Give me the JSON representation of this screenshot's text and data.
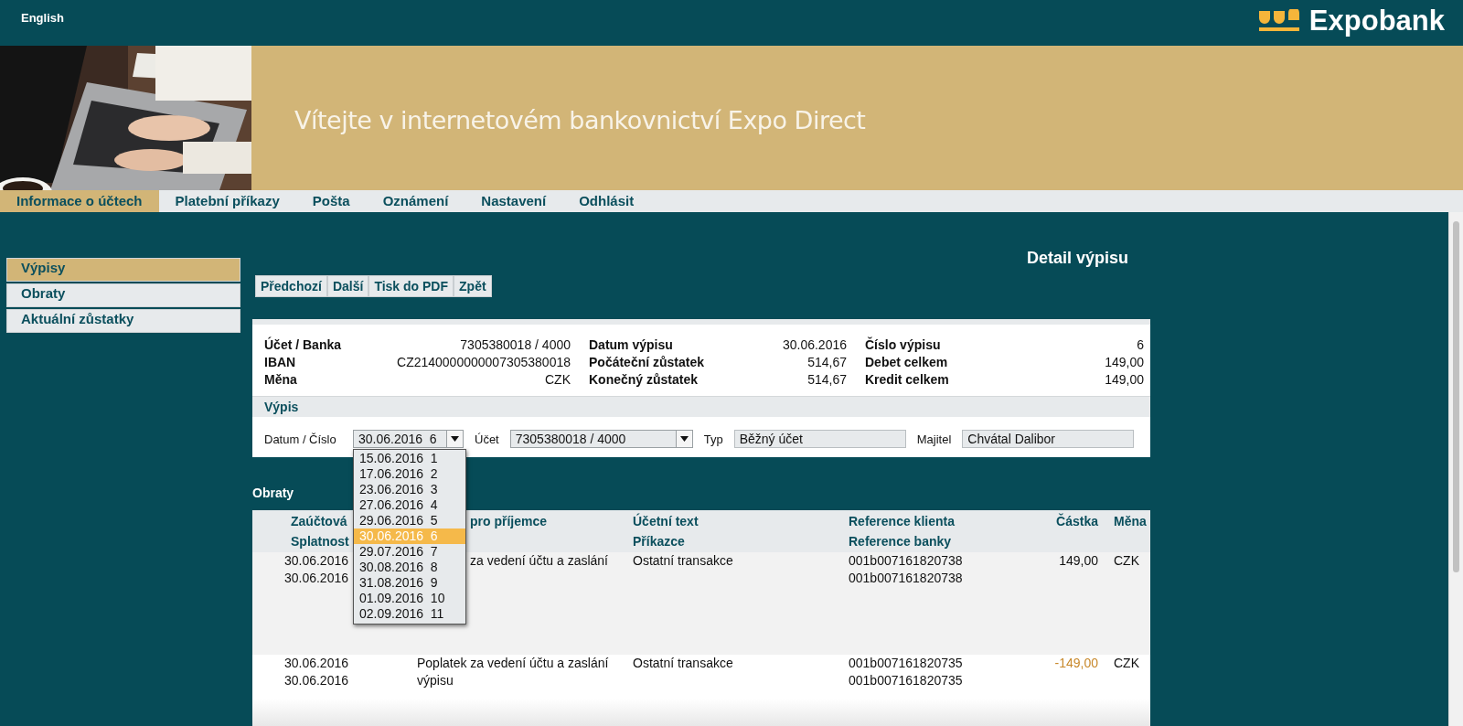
{
  "header": {
    "language_link": "English",
    "logo_text": "Expobank"
  },
  "banner": {
    "welcome": "Vítejte v internetovém bankovnictví Expo Direct"
  },
  "nav_tabs": [
    {
      "label": "Informace o účtech",
      "selected": true
    },
    {
      "label": "Platební příkazy",
      "selected": false
    },
    {
      "label": "Pošta",
      "selected": false
    },
    {
      "label": "Oznámení",
      "selected": false
    },
    {
      "label": "Nastavení",
      "selected": false
    },
    {
      "label": "Odhlásit",
      "selected": false
    }
  ],
  "sidebar": {
    "items": [
      {
        "label": "Výpisy",
        "selected": true
      },
      {
        "label": "Obraty",
        "selected": false
      },
      {
        "label": "Aktuální zůstatky",
        "selected": false
      }
    ]
  },
  "page_title": "Detail výpisu",
  "toolbar_buttons": [
    "Předchozí",
    "Další",
    "Tisk do PDF",
    "Zpět"
  ],
  "summary": {
    "fields": [
      {
        "label": "Účet  / Banka",
        "value": "7305380018 / 4000"
      },
      {
        "label": "Datum výpisu",
        "value": "30.06.2016"
      },
      {
        "label": "Číslo výpisu",
        "value": "6"
      },
      {
        "label": "IBAN",
        "value": "CZ2140000000007305380018"
      },
      {
        "label": "Počáteční zůstatek",
        "value": "514,67"
      },
      {
        "label": "Debet celkem",
        "value": "149,00"
      },
      {
        "label": "Měna",
        "value": "CZK"
      },
      {
        "label": "Konečný zůstatek",
        "value": "514,67"
      },
      {
        "label": "Kredit celkem",
        "value": "149,00"
      }
    ]
  },
  "statement": {
    "title": "Výpis",
    "controls": [
      {
        "kind": "select",
        "label": "Datum / Číslo",
        "value": "30.06.2016  6",
        "expanded": true,
        "options": [
          {
            "label": "15.06.2016  1",
            "selected": false
          },
          {
            "label": "17.06.2016  2",
            "selected": false
          },
          {
            "label": "23.06.2016  3",
            "selected": false
          },
          {
            "label": "27.06.2016  4",
            "selected": false
          },
          {
            "label": "29.06.2016  5",
            "selected": false
          },
          {
            "label": "30.06.2016  6",
            "selected": true
          },
          {
            "label": "29.07.2016  7",
            "selected": false
          },
          {
            "label": "30.08.2016  8",
            "selected": false
          },
          {
            "label": "31.08.2016  9",
            "selected": false
          },
          {
            "label": "01.09.2016  10",
            "selected": false
          },
          {
            "label": "02.09.2016  11",
            "selected": false
          }
        ]
      },
      {
        "kind": "select",
        "label": "Účet",
        "value": "7305380018 / 4000",
        "expanded": false
      },
      {
        "kind": "field",
        "label": "Typ",
        "value": "Běžný účet"
      },
      {
        "kind": "field",
        "label": "Majitel",
        "value": "Chvátal Dalibor"
      }
    ]
  },
  "turnovers": {
    "title": "Obraty",
    "columns": [
      {
        "lines": [
          "Zaúčtová",
          "Splatnost"
        ]
      },
      {
        "lines": [
          "pro příjemce"
        ],
        "partly_hidden": true
      },
      {
        "lines": [
          "Účetní text",
          "Příkazce"
        ]
      },
      {
        "lines": [
          "Reference klienta",
          "Reference banky"
        ]
      },
      {
        "lines": [
          "Částka"
        ]
      },
      {
        "lines": [
          "Měna"
        ]
      }
    ],
    "rows": [
      {
        "debit": false,
        "partly_hidden": true,
        "cells": [
          [
            "30.06.2016",
            "30.06.2016"
          ],
          [
            "za vedení účtu a zaslání"
          ],
          [
            "Ostatní transakce"
          ],
          [
            "001b007161820738",
            "001b007161820738"
          ],
          [
            "149,00"
          ],
          [
            "CZK"
          ]
        ]
      },
      {
        "debit": true,
        "cells": [
          [
            "30.06.2016",
            "30.06.2016"
          ],
          [
            "Poplatek za vedení účtu a zaslání",
            "výpisu"
          ],
          [
            "Ostatní transakce"
          ],
          [
            "001b007161820735",
            "001b007161820735"
          ],
          [
            "-149,00"
          ],
          [
            "CZK"
          ]
        ]
      }
    ]
  }
}
